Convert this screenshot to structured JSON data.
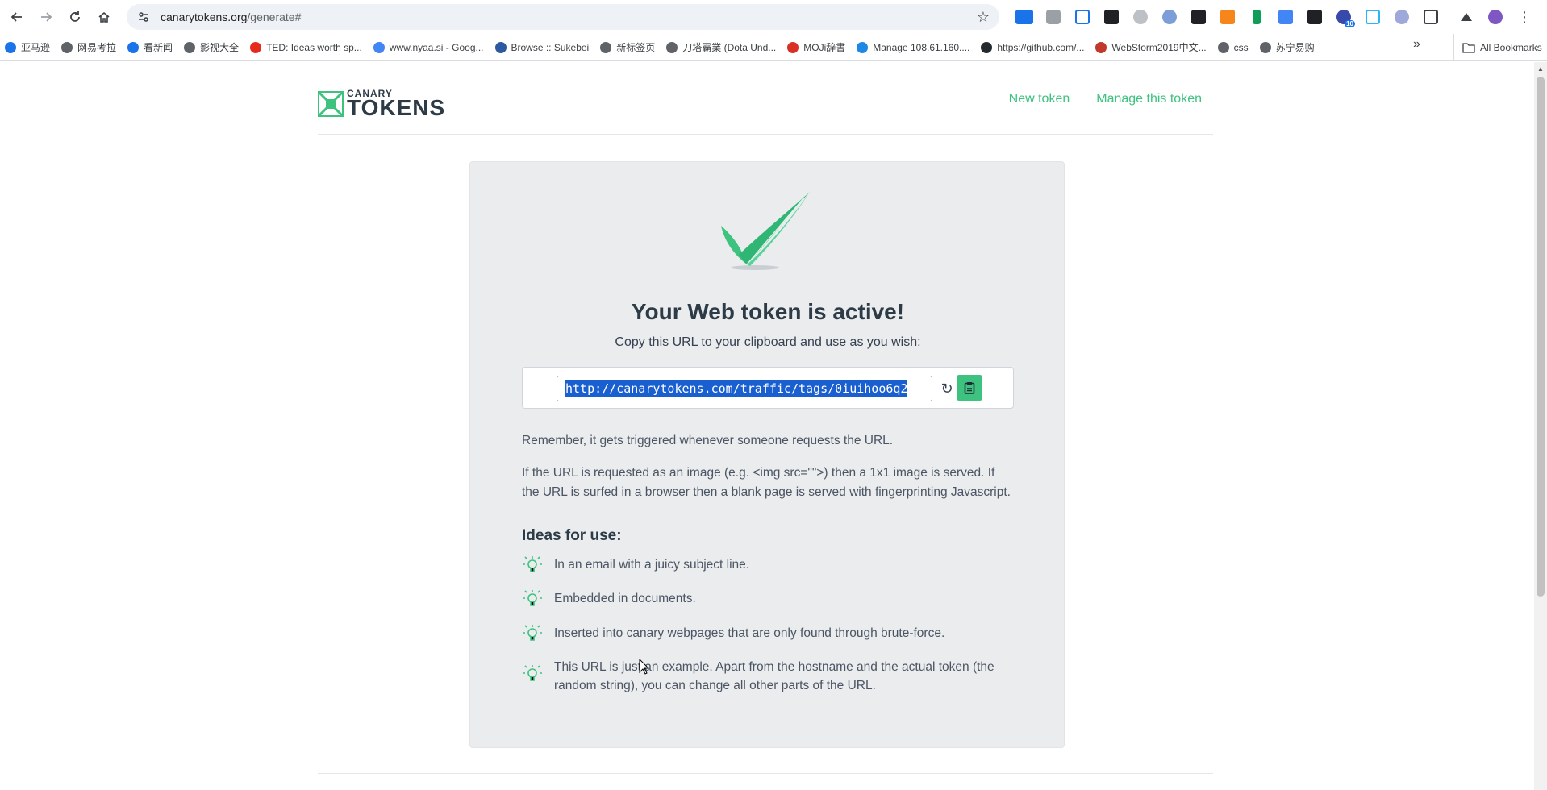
{
  "browser": {
    "url_host": "canarytokens.org",
    "url_path": "/generate#",
    "extension_badge": "10"
  },
  "bookmarks": [
    {
      "label": "亚马逊",
      "color": "#1a73e8"
    },
    {
      "label": "网易考拉",
      "color": "#5f6368"
    },
    {
      "label": "看新闻",
      "color": "#1a73e8"
    },
    {
      "label": "影视大全",
      "color": "#5f6368"
    },
    {
      "label": "TED: Ideas worth sp...",
      "color": "#e62b1e"
    },
    {
      "label": "www.nyaa.si - Goog...",
      "color": "#4285f4"
    },
    {
      "label": "Browse :: Sukebei",
      "color": "#2c5aa0"
    },
    {
      "label": "新标签页",
      "color": "#5f6368"
    },
    {
      "label": "刀塔霸業 (Dota Und...",
      "color": "#5f6368"
    },
    {
      "label": "MOJi辞書",
      "color": "#d93025"
    },
    {
      "label": "Manage 108.61.160....",
      "color": "#1e88e5"
    },
    {
      "label": "https://github.com/...",
      "color": "#24292e"
    },
    {
      "label": "WebStorm2019中文...",
      "color": "#c0392b"
    },
    {
      "label": "css",
      "color": "#5f6368"
    },
    {
      "label": "苏宁易购",
      "color": "#5f6368"
    }
  ],
  "bookmarks_all": "All Bookmarks",
  "site": {
    "logo_small": "CANARY",
    "logo_big": "TOKENS",
    "nav_new_token": "New token",
    "nav_manage_token": "Manage this token",
    "brand_color": "#3ec27f"
  },
  "token": {
    "heading": "Your Web token is active!",
    "subheading": "Copy this URL to your clipboard and use as you wish:",
    "url": "http://canarytokens.com/traffic/tags/0iuihoo6q2"
  },
  "info": {
    "p1": "Remember, it gets triggered whenever someone requests the URL.",
    "p2": "If the URL is requested as an image (e.g. <img src=\"\">) then a 1x1 image is served. If the URL is surfed in a browser then a blank page is served with fingerprinting Javascript."
  },
  "ideas": {
    "title": "Ideas for use:",
    "items": [
      "In an email with a juicy subject line.",
      "Embedded in documents.",
      "Inserted into canary webpages that are only found through brute-force.",
      "This URL is just an example. Apart from the hostname and the actual token (the random string), you can change all other parts of the URL."
    ]
  }
}
